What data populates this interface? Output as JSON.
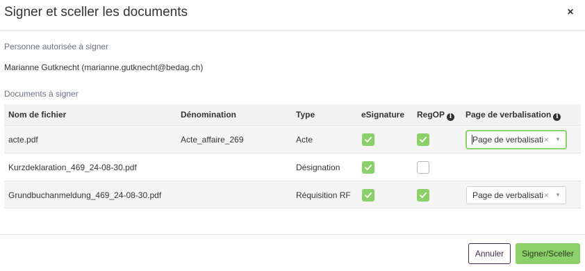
{
  "dialog": {
    "title": "Signer et sceller les documents",
    "close_label": "×"
  },
  "signer": {
    "label": "Personne autorisée à signer",
    "name": "Marianne Gutknecht (marianne.gutknecht@bedag.ch)"
  },
  "documents": {
    "label": "Documents à signer",
    "columns": {
      "filename": "Nom de fichier",
      "denomination": "Dénomination",
      "type": "Type",
      "esignature": "eSignature",
      "regop": "RegOP",
      "verbalisation": "Page de verbalisation"
    },
    "rows": [
      {
        "filename": "acte.pdf",
        "denomination": "Acte_affaire_269",
        "type": "Acte",
        "esignature": true,
        "regop": true,
        "verbalisation": "Page de verbalisation"
      },
      {
        "filename": "Kurzdeklaration_469_24-08-30.pdf",
        "denomination": "",
        "type": "Désignation",
        "esignature": true,
        "regop": false,
        "verbalisation": ""
      },
      {
        "filename": "Grundbuchanmeldung_469_24-08-30.pdf",
        "denomination": "",
        "type": "Réquisition RF",
        "esignature": true,
        "regop": true,
        "verbalisation": "Page de verbalisation"
      }
    ]
  },
  "select": {
    "clear_label": "×",
    "arrow": "▼"
  },
  "footer": {
    "cancel_label": "Annuler",
    "sign_label": "Signer/Sceller"
  },
  "colors": {
    "accent_green": "#8cd06a",
    "cancel_border": "#3f2a4a"
  },
  "icons": {
    "info": "info-circle-icon",
    "check": "check-icon",
    "close": "close-icon"
  }
}
